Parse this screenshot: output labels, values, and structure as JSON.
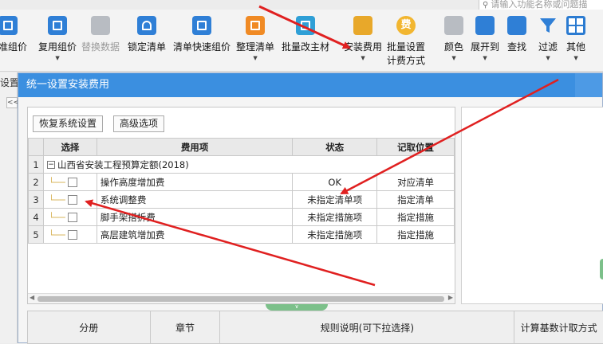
{
  "search": {
    "placeholder": "请输入功能名称或问题描"
  },
  "toolbar": {
    "items": [
      {
        "label": "标准组价",
        "icon": "grid-price-icon",
        "enabled": true
      },
      {
        "label": "复用组价",
        "icon": "reuse-price-icon",
        "enabled": true
      },
      {
        "label": "替换数据",
        "icon": "replace-data-icon",
        "enabled": false
      },
      {
        "label": "锁定清单",
        "icon": "lock-icon",
        "enabled": true
      },
      {
        "label": "清单快速组价",
        "icon": "quick-price-icon",
        "enabled": true
      },
      {
        "label": "整理清单",
        "icon": "organize-list-icon",
        "enabled": true
      },
      {
        "label": "批量改主材",
        "icon": "batch-material-icon",
        "enabled": true
      },
      {
        "label": "安装费用",
        "icon": "install-fee-icon",
        "enabled": true
      },
      {
        "label": "批量设置\n计费方式",
        "label1": "批量设置",
        "label2": "计费方式",
        "icon": "fee-icon",
        "enabled": true
      },
      {
        "label": "颜色",
        "icon": "color-bucket-icon",
        "enabled": true
      },
      {
        "label": "展开到",
        "icon": "expand-icon",
        "enabled": true
      },
      {
        "label": "查找",
        "icon": "binoculars-icon",
        "enabled": true
      },
      {
        "label": "过滤",
        "icon": "filter-icon",
        "enabled": true
      },
      {
        "label": "其他",
        "icon": "more-grid-icon",
        "enabled": true
      }
    ]
  },
  "left": {
    "label": "设置",
    "collapse": "<<"
  },
  "dialog": {
    "title": "统一设置安装费用",
    "buttons": {
      "restore": "恢复系统设置",
      "advanced": "高级选项"
    },
    "table": {
      "headers": {
        "select": "选择",
        "item": "费用项",
        "status": "状态",
        "location": "记取位置"
      },
      "group": {
        "num": "1",
        "name": "山西省安装工程预算定额(2018)"
      },
      "rows": [
        {
          "num": "2",
          "name": "操作高度增加费",
          "status": "OK",
          "location": "对应清单"
        },
        {
          "num": "3",
          "name": "系统调整费",
          "status": "未指定清单项",
          "location": "指定清单"
        },
        {
          "num": "4",
          "name": "脚手架搭拆费",
          "status": "未指定措施项",
          "location": "指定措施"
        },
        {
          "num": "5",
          "name": "高层建筑增加费",
          "status": "未指定措施项",
          "location": "指定措施"
        }
      ]
    },
    "bottom_headers": [
      "分册",
      "章节",
      "规则说明(可下拉选择)",
      "计算基数计取方式"
    ]
  },
  "colors": {
    "title_bar": "#3b8fe0",
    "annotation": "#e02020",
    "splitter": "#7cc08a"
  }
}
